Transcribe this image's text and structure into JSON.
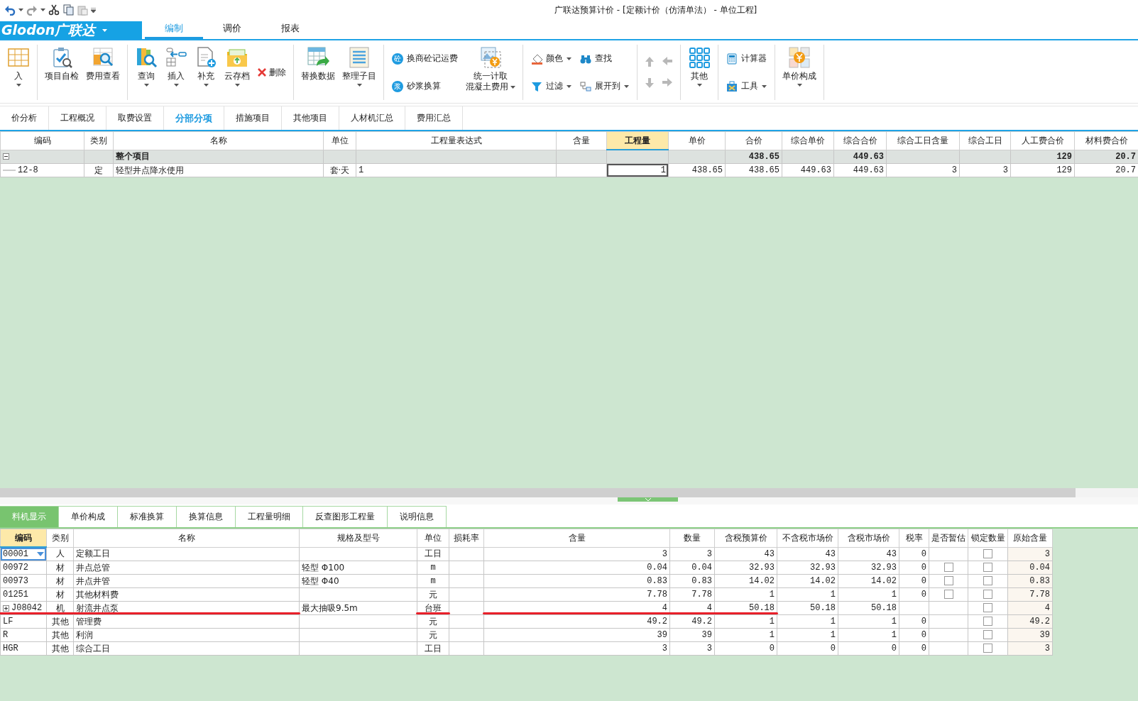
{
  "titlebar": {
    "title": "广联达预算计价 - [定额计价（仿清单法） - 单位工程]"
  },
  "menubar": {
    "logo": "Glodon广联达",
    "tabs": [
      {
        "label": "编制",
        "selected": true
      },
      {
        "label": "调价",
        "selected": false
      },
      {
        "label": "报表",
        "selected": false
      }
    ]
  },
  "ribbon": [
    {
      "items": [
        {
          "kind": "large",
          "label": "入",
          "dropdown": true
        }
      ]
    },
    {
      "items": [
        {
          "kind": "large",
          "label": "项目自检",
          "dropdown": false
        },
        {
          "kind": "large",
          "label": "费用查看",
          "dropdown": false
        }
      ]
    },
    {
      "items": [
        {
          "kind": "large",
          "label": "查询",
          "dropdown": true
        },
        {
          "kind": "large",
          "label": "插入",
          "dropdown": true
        },
        {
          "kind": "large",
          "label": "补充",
          "dropdown": true
        },
        {
          "kind": "large",
          "label": "云存档",
          "dropdown": true
        },
        {
          "kind": "inline",
          "label": "删除"
        }
      ]
    },
    {
      "items": [
        {
          "kind": "large",
          "label": "替换数据",
          "dropdown": false
        },
        {
          "kind": "large",
          "label": "整理子目",
          "dropdown": true
        }
      ]
    },
    {
      "items": [
        {
          "kind": "stack",
          "items": [
            {
              "label": "换商砼记运费",
              "badge": "砼",
              "dropdown": false
            },
            {
              "label": "砂浆换算",
              "badge": "浆",
              "dropdown": false
            }
          ]
        },
        {
          "kind": "large",
          "label": [
            "统一计取",
            "混凝土费用"
          ],
          "dropdown": true
        }
      ]
    },
    {
      "items": [
        {
          "kind": "stack",
          "items": [
            {
              "label": "颜色",
              "dropdown": true
            },
            {
              "label": "过滤",
              "dropdown": true
            }
          ]
        },
        {
          "kind": "stack",
          "items": [
            {
              "label": "查找",
              "dropdown": false
            },
            {
              "label": "展开到",
              "dropdown": true
            }
          ]
        }
      ]
    },
    {
      "items": [
        {
          "kind": "arrows",
          "items": [
            {
              "disabled": true
            },
            {
              "disabled": true
            },
            {
              "disabled": true
            },
            {
              "disabled": true
            }
          ]
        }
      ]
    },
    {
      "items": [
        {
          "kind": "large",
          "label": "其他",
          "dropdown": true
        }
      ]
    },
    {
      "items": [
        {
          "kind": "stack",
          "items": [
            {
              "label": "计算器",
              "dropdown": false
            },
            {
              "label": "工具",
              "dropdown": true
            }
          ]
        }
      ]
    },
    {
      "items": [
        {
          "kind": "large",
          "label": "单价构成",
          "dropdown": true
        }
      ]
    }
  ],
  "view_tabs": [
    {
      "label": "价分析",
      "selected": false
    },
    {
      "label": "工程概况",
      "selected": false
    },
    {
      "label": "取费设置",
      "selected": false
    },
    {
      "label": "分部分项",
      "selected": true
    },
    {
      "label": "措施项目",
      "selected": false
    },
    {
      "label": "其他项目",
      "selected": false
    },
    {
      "label": "人材机汇总",
      "selected": false
    },
    {
      "label": "费用汇总",
      "selected": false
    }
  ],
  "upper_table": {
    "columns": [
      {
        "label": "编码",
        "selected": false
      },
      {
        "label": "类别",
        "selected": false
      },
      {
        "label": "名称",
        "selected": false
      },
      {
        "label": "单位",
        "selected": false
      },
      {
        "label": "工程量表达式",
        "selected": false
      },
      {
        "label": "含量",
        "selected": false
      },
      {
        "label": "工程量",
        "selected": true
      },
      {
        "label": "单价",
        "selected": false
      },
      {
        "label": "合价",
        "selected": false
      },
      {
        "label": "综合单价",
        "selected": false
      },
      {
        "label": "综合合价",
        "selected": false
      },
      {
        "label": "综合工日含量",
        "selected": false
      },
      {
        "label": "综合工日",
        "selected": false
      },
      {
        "label": "人工费合价",
        "selected": false
      },
      {
        "label": "材料费合价",
        "selected": false
      }
    ],
    "rows": [
      {
        "kind": "group",
        "expanded": true,
        "selected": false,
        "cells": [
          null,
          null,
          "整个项目",
          null,
          null,
          null,
          null,
          null,
          "438.65",
          null,
          "449.63",
          null,
          null,
          "129",
          "20.7"
        ]
      },
      {
        "kind": "item",
        "selected": true,
        "cells": [
          "12-8",
          "定",
          "轻型井点降水使用",
          "套·天",
          "1",
          null,
          "1",
          "438.65",
          "438.65",
          "449.63",
          "449.63",
          "3",
          "3",
          "129",
          "20.7"
        ]
      }
    ]
  },
  "detail_tabs": [
    {
      "label": "料机显示",
      "selected": true
    },
    {
      "label": "单价构成",
      "selected": false
    },
    {
      "label": "标准换算",
      "selected": false
    },
    {
      "label": "换算信息",
      "selected": false
    },
    {
      "label": "工程量明细",
      "selected": false
    },
    {
      "label": "反查图形工程量",
      "selected": false
    },
    {
      "label": "说明信息",
      "selected": false
    }
  ],
  "lower_table": {
    "columns": [
      {
        "label": "编码",
        "selected": true
      },
      {
        "label": "类别",
        "selected": false
      },
      {
        "label": "名称",
        "selected": false
      },
      {
        "label": "规格及型号",
        "selected": false
      },
      {
        "label": "单位",
        "selected": false
      },
      {
        "label": "损耗率",
        "selected": false
      },
      {
        "label": "含量",
        "selected": false
      },
      {
        "label": "数量",
        "selected": false
      },
      {
        "label": "含税预算价",
        "selected": false
      },
      {
        "label": "不含税市场价",
        "selected": false
      },
      {
        "label": "含税市场价",
        "selected": false
      },
      {
        "label": "税率",
        "selected": false
      },
      {
        "label": "是否暂估",
        "selected": false
      },
      {
        "label": "锁定数量",
        "selected": false
      },
      {
        "label": "原始含量",
        "selected": false
      }
    ],
    "rows": [
      {
        "selected": true,
        "cells": [
          "00001",
          "人",
          "定额工日",
          null,
          "工日",
          null,
          "3",
          "3",
          "43",
          "43",
          "43",
          "0",
          null,
          {
            "checked": false
          },
          "3"
        ]
      },
      {
        "selected": false,
        "cells": [
          "00972",
          "材",
          "井点总管",
          "轻型 Φ100",
          "m",
          null,
          "0.04",
          "0.04",
          "32.93",
          "32.93",
          "32.93",
          "0",
          {
            "checked": false
          },
          {
            "checked": false
          },
          "0.04"
        ]
      },
      {
        "selected": false,
        "cells": [
          "00973",
          "材",
          "井点井管",
          "轻型 Φ40",
          "m",
          null,
          "0.83",
          "0.83",
          "14.02",
          "14.02",
          "14.02",
          "0",
          {
            "checked": false
          },
          {
            "checked": false
          },
          "0.83"
        ]
      },
      {
        "selected": false,
        "cells": [
          "01251",
          "材",
          "其他材料费",
          null,
          "元",
          null,
          "7.78",
          "7.78",
          "1",
          "1",
          "1",
          "0",
          {
            "checked": false
          },
          {
            "checked": false
          },
          "7.78"
        ]
      },
      {
        "selected": false,
        "expanded": false,
        "red_marked": true,
        "cells": [
          "J08042",
          "机",
          "射流井点泵",
          "最大抽吸9.5m",
          "台班",
          null,
          "4",
          "4",
          "50.18",
          "50.18",
          "50.18",
          null,
          null,
          {
            "checked": false
          },
          "4"
        ]
      },
      {
        "selected": false,
        "cells": [
          "LF",
          "其他",
          "管理费",
          null,
          "元",
          null,
          "49.2",
          "49.2",
          "1",
          "1",
          "1",
          "0",
          null,
          {
            "checked": false
          },
          "49.2"
        ]
      },
      {
        "selected": false,
        "cells": [
          "R",
          "其他",
          "利润",
          null,
          "元",
          null,
          "39",
          "39",
          "1",
          "1",
          "1",
          "0",
          null,
          {
            "checked": false
          },
          "39"
        ]
      },
      {
        "selected": false,
        "cells": [
          "HGR",
          "其他",
          "综合工日",
          null,
          "工日",
          null,
          "3",
          "3",
          "0",
          "0",
          "0",
          "0",
          null,
          {
            "checked": false
          },
          "3"
        ]
      }
    ]
  }
}
